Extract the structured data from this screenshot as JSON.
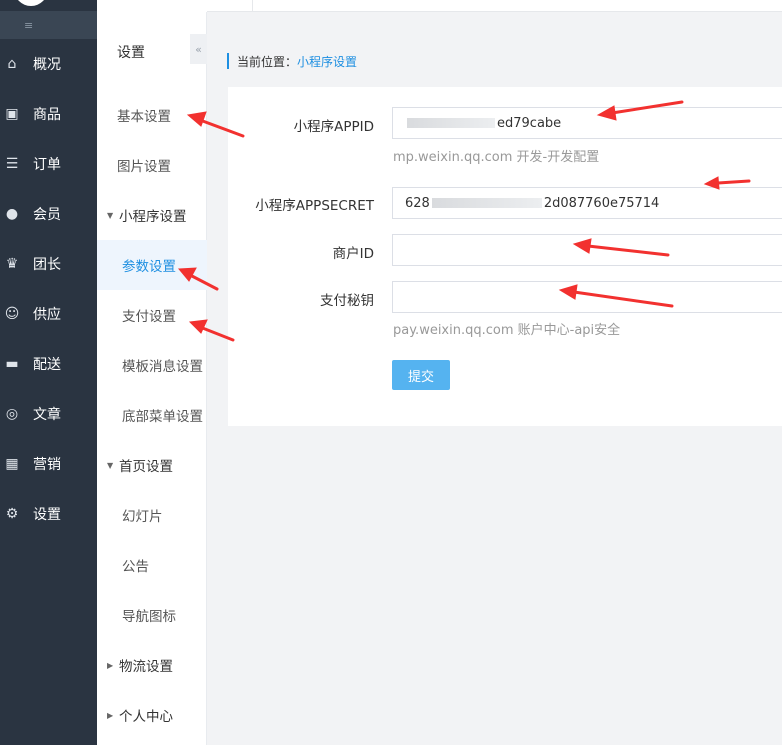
{
  "nav": {
    "collapse_glyph": "≡",
    "items": [
      {
        "label": "概况",
        "icon": "home-icon",
        "glyph": "⌂"
      },
      {
        "label": "商品",
        "icon": "bag-icon",
        "glyph": "▣"
      },
      {
        "label": "订单",
        "icon": "document-icon",
        "glyph": "☰"
      },
      {
        "label": "会员",
        "icon": "users-icon",
        "glyph": "●"
      },
      {
        "label": "团长",
        "icon": "crown-icon",
        "glyph": "♛"
      },
      {
        "label": "供应",
        "icon": "supplier-icon",
        "glyph": "☺"
      },
      {
        "label": "配送",
        "icon": "truck-icon",
        "glyph": "▬"
      },
      {
        "label": "文章",
        "icon": "compass-icon",
        "glyph": "◎"
      },
      {
        "label": "营销",
        "icon": "gift-icon",
        "glyph": "▦"
      },
      {
        "label": "设置",
        "icon": "gear-icon",
        "glyph": "⚙"
      }
    ]
  },
  "submenu": {
    "title": "设置",
    "toggle_glyph": "«",
    "basic": "基本设置",
    "image": "图片设置",
    "miniprogram_group": "小程序设置",
    "params": "参数设置",
    "payment": "支付设置",
    "template_msg": "模板消息设置",
    "bottom_menu": "底部菜单设置",
    "home_group": "首页设置",
    "slides": "幻灯片",
    "notice": "公告",
    "nav_icons": "导航图标",
    "logistics_group": "物流设置",
    "personal_group": "个人中心",
    "caret_down": "▼",
    "caret_right": "▶"
  },
  "breadcrumb": {
    "prefix": "当前位置：",
    "current": "小程序设置"
  },
  "form": {
    "appid_label": "小程序APPID",
    "appid_visible_suffix": "ed79cabe",
    "appid_help": "mp.weixin.qq.com 开发-开发配置",
    "secret_label": "小程序APPSECRET",
    "secret_visible_prefix": "628",
    "secret_visible_suffix": "2d087760e75714",
    "merchant_label": "商户ID",
    "pay_key_label": "支付秘钥",
    "pay_help": "pay.weixin.qq.com 账户中心-api安全",
    "submit_label": "提交"
  },
  "colors": {
    "nav_bg": "#2a3441",
    "accent": "#1e8fe1",
    "submit_bg": "#55b3f0",
    "arrow": "#f2312f"
  }
}
